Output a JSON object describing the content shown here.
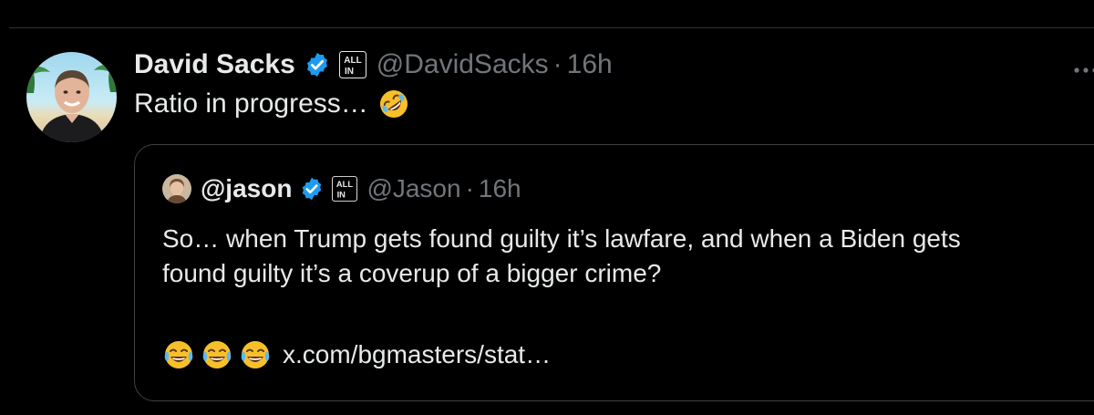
{
  "tweet": {
    "author_name": "David Sacks",
    "handle": "@DavidSacks",
    "separator": "·",
    "time": "16h",
    "text": "Ratio in progress…",
    "text_emoji": "rolling-on-floor-laughing-emoji",
    "verified_icon": "verified-badge-icon",
    "affiliate_badge": "all-in-badge-icon",
    "more_icon": "more-options-icon"
  },
  "quote": {
    "author_name": "@jason",
    "handle": "@Jason",
    "separator": "·",
    "time": "16h",
    "text_line1": "So… when Trump gets found guilty it’s lawfare, and when a Biden gets",
    "text_line2": "found guilty it’s a coverup of a bigger crime?",
    "footer_emojis": [
      "face-with-tears-of-joy-emoji",
      "face-with-tears-of-joy-emoji",
      "face-with-tears-of-joy-emoji"
    ],
    "link": "x.com/bgmasters/stat…"
  },
  "colors": {
    "background": "#000000",
    "text_primary": "#e7e9ea",
    "text_secondary": "#71767b",
    "verified_blue": "#1d9bf0",
    "border": "#3d4145"
  }
}
